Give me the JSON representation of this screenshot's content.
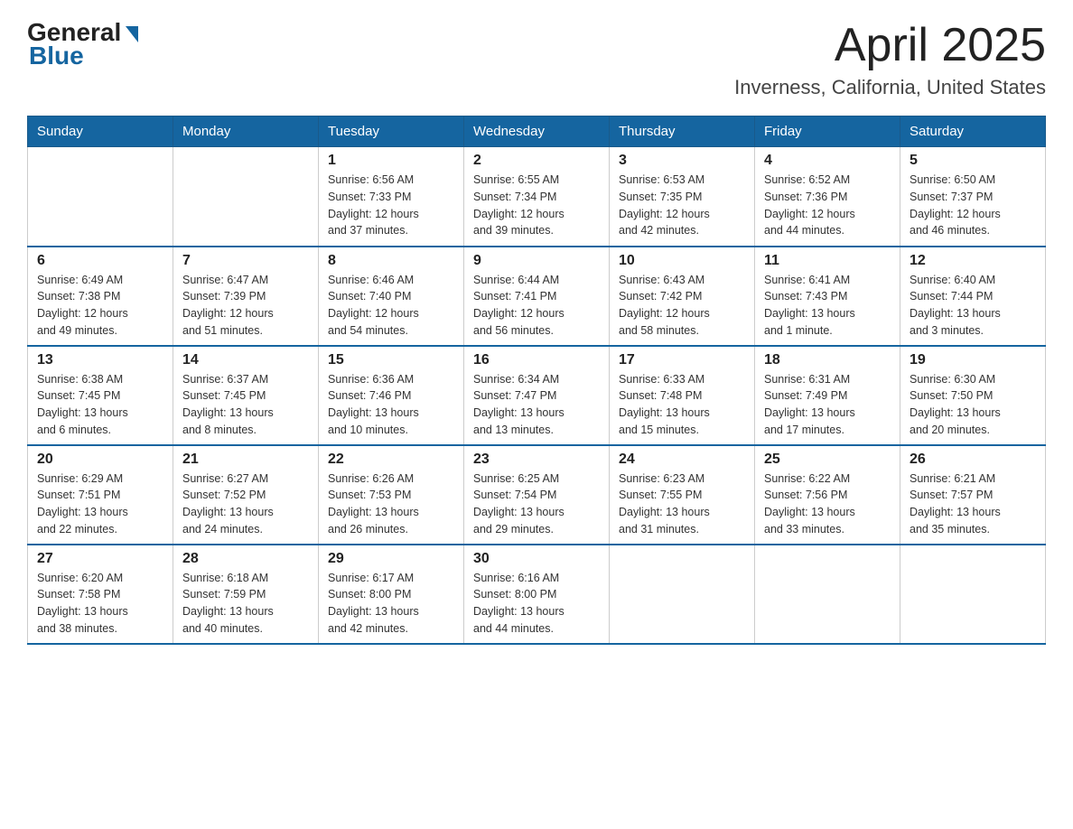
{
  "header": {
    "logo_general": "General",
    "logo_blue": "Blue",
    "title": "April 2025",
    "subtitle": "Inverness, California, United States"
  },
  "calendar": {
    "headers": [
      "Sunday",
      "Monday",
      "Tuesday",
      "Wednesday",
      "Thursday",
      "Friday",
      "Saturday"
    ],
    "rows": [
      [
        {
          "day": "",
          "info": ""
        },
        {
          "day": "",
          "info": ""
        },
        {
          "day": "1",
          "info": "Sunrise: 6:56 AM\nSunset: 7:33 PM\nDaylight: 12 hours\nand 37 minutes."
        },
        {
          "day": "2",
          "info": "Sunrise: 6:55 AM\nSunset: 7:34 PM\nDaylight: 12 hours\nand 39 minutes."
        },
        {
          "day": "3",
          "info": "Sunrise: 6:53 AM\nSunset: 7:35 PM\nDaylight: 12 hours\nand 42 minutes."
        },
        {
          "day": "4",
          "info": "Sunrise: 6:52 AM\nSunset: 7:36 PM\nDaylight: 12 hours\nand 44 minutes."
        },
        {
          "day": "5",
          "info": "Sunrise: 6:50 AM\nSunset: 7:37 PM\nDaylight: 12 hours\nand 46 minutes."
        }
      ],
      [
        {
          "day": "6",
          "info": "Sunrise: 6:49 AM\nSunset: 7:38 PM\nDaylight: 12 hours\nand 49 minutes."
        },
        {
          "day": "7",
          "info": "Sunrise: 6:47 AM\nSunset: 7:39 PM\nDaylight: 12 hours\nand 51 minutes."
        },
        {
          "day": "8",
          "info": "Sunrise: 6:46 AM\nSunset: 7:40 PM\nDaylight: 12 hours\nand 54 minutes."
        },
        {
          "day": "9",
          "info": "Sunrise: 6:44 AM\nSunset: 7:41 PM\nDaylight: 12 hours\nand 56 minutes."
        },
        {
          "day": "10",
          "info": "Sunrise: 6:43 AM\nSunset: 7:42 PM\nDaylight: 12 hours\nand 58 minutes."
        },
        {
          "day": "11",
          "info": "Sunrise: 6:41 AM\nSunset: 7:43 PM\nDaylight: 13 hours\nand 1 minute."
        },
        {
          "day": "12",
          "info": "Sunrise: 6:40 AM\nSunset: 7:44 PM\nDaylight: 13 hours\nand 3 minutes."
        }
      ],
      [
        {
          "day": "13",
          "info": "Sunrise: 6:38 AM\nSunset: 7:45 PM\nDaylight: 13 hours\nand 6 minutes."
        },
        {
          "day": "14",
          "info": "Sunrise: 6:37 AM\nSunset: 7:45 PM\nDaylight: 13 hours\nand 8 minutes."
        },
        {
          "day": "15",
          "info": "Sunrise: 6:36 AM\nSunset: 7:46 PM\nDaylight: 13 hours\nand 10 minutes."
        },
        {
          "day": "16",
          "info": "Sunrise: 6:34 AM\nSunset: 7:47 PM\nDaylight: 13 hours\nand 13 minutes."
        },
        {
          "day": "17",
          "info": "Sunrise: 6:33 AM\nSunset: 7:48 PM\nDaylight: 13 hours\nand 15 minutes."
        },
        {
          "day": "18",
          "info": "Sunrise: 6:31 AM\nSunset: 7:49 PM\nDaylight: 13 hours\nand 17 minutes."
        },
        {
          "day": "19",
          "info": "Sunrise: 6:30 AM\nSunset: 7:50 PM\nDaylight: 13 hours\nand 20 minutes."
        }
      ],
      [
        {
          "day": "20",
          "info": "Sunrise: 6:29 AM\nSunset: 7:51 PM\nDaylight: 13 hours\nand 22 minutes."
        },
        {
          "day": "21",
          "info": "Sunrise: 6:27 AM\nSunset: 7:52 PM\nDaylight: 13 hours\nand 24 minutes."
        },
        {
          "day": "22",
          "info": "Sunrise: 6:26 AM\nSunset: 7:53 PM\nDaylight: 13 hours\nand 26 minutes."
        },
        {
          "day": "23",
          "info": "Sunrise: 6:25 AM\nSunset: 7:54 PM\nDaylight: 13 hours\nand 29 minutes."
        },
        {
          "day": "24",
          "info": "Sunrise: 6:23 AM\nSunset: 7:55 PM\nDaylight: 13 hours\nand 31 minutes."
        },
        {
          "day": "25",
          "info": "Sunrise: 6:22 AM\nSunset: 7:56 PM\nDaylight: 13 hours\nand 33 minutes."
        },
        {
          "day": "26",
          "info": "Sunrise: 6:21 AM\nSunset: 7:57 PM\nDaylight: 13 hours\nand 35 minutes."
        }
      ],
      [
        {
          "day": "27",
          "info": "Sunrise: 6:20 AM\nSunset: 7:58 PM\nDaylight: 13 hours\nand 38 minutes."
        },
        {
          "day": "28",
          "info": "Sunrise: 6:18 AM\nSunset: 7:59 PM\nDaylight: 13 hours\nand 40 minutes."
        },
        {
          "day": "29",
          "info": "Sunrise: 6:17 AM\nSunset: 8:00 PM\nDaylight: 13 hours\nand 42 minutes."
        },
        {
          "day": "30",
          "info": "Sunrise: 6:16 AM\nSunset: 8:00 PM\nDaylight: 13 hours\nand 44 minutes."
        },
        {
          "day": "",
          "info": ""
        },
        {
          "day": "",
          "info": ""
        },
        {
          "day": "",
          "info": ""
        }
      ]
    ]
  }
}
